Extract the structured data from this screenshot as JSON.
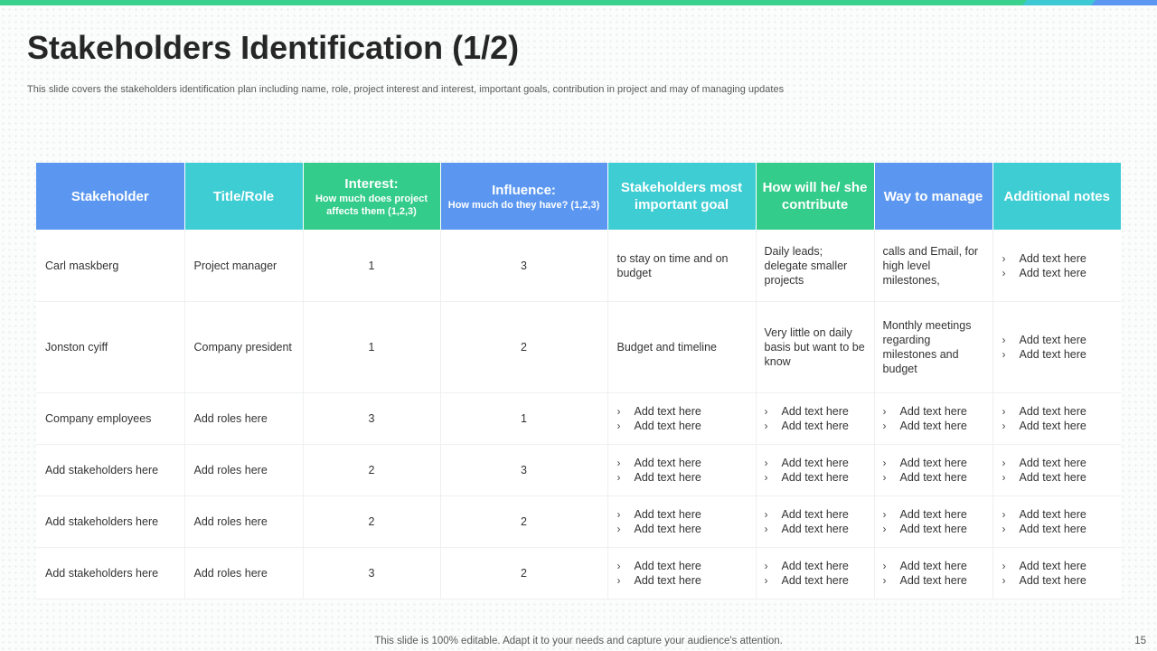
{
  "slide": {
    "title": "Stakeholders Identification (1/2)",
    "subtitle": "This slide covers the stakeholders identification plan including name, role, project interest and interest, important goals, contribution in project and may of managing updates",
    "footer": "This slide is 100% editable. Adapt it to your needs and capture your audience's attention.",
    "page_number": "15"
  },
  "colors": {
    "blue": "#5b97f0",
    "teal": "#3ecdd3",
    "green": "#33cc8a"
  },
  "table": {
    "headers": [
      {
        "label": "Stakeholder",
        "sub": ""
      },
      {
        "label": "Title/Role",
        "sub": ""
      },
      {
        "label": "Interest:",
        "sub": "How much does project affects them (1,2,3)"
      },
      {
        "label": "Influence:",
        "sub": "How much do they have? (1,2,3)"
      },
      {
        "label": "Stakeholders most important goal",
        "sub": ""
      },
      {
        "label": "How will he/ she contribute",
        "sub": ""
      },
      {
        "label": "Way to manage",
        "sub": ""
      },
      {
        "label": "Additional notes",
        "sub": ""
      }
    ],
    "rows": [
      {
        "stakeholder": "Carl maskberg",
        "role": "Project manager",
        "interest": "1",
        "influence": "3",
        "goal": "to stay on time and on budget",
        "contribute": "Daily leads; delegate smaller projects",
        "manage": "calls and Email, for high level milestones,",
        "notes": [
          "Add text here",
          "Add text here"
        ]
      },
      {
        "stakeholder": "Jonston cyiff",
        "role": "Company president",
        "interest": "1",
        "influence": "2",
        "goal": "Budget and timeline",
        "contribute": "Very little on daily basis but want to be know",
        "manage": "Monthly meetings regarding milestones and budget",
        "notes": [
          "Add text here",
          "Add text here"
        ]
      },
      {
        "stakeholder": "Company employees",
        "role": "Add roles here",
        "interest": "3",
        "influence": "1",
        "goal": [
          "Add text here",
          "Add text here"
        ],
        "contribute": [
          "Add text here",
          "Add text here"
        ],
        "manage": [
          "Add text here",
          "Add text here"
        ],
        "notes": [
          "Add text here",
          "Add text here"
        ]
      },
      {
        "stakeholder": "Add stakeholders here",
        "role": "Add roles here",
        "interest": "2",
        "influence": "3",
        "goal": [
          "Add text here",
          "Add text here"
        ],
        "contribute": [
          "Add text here",
          "Add text here"
        ],
        "manage": [
          "Add text here",
          "Add text here"
        ],
        "notes": [
          "Add text here",
          "Add text here"
        ]
      },
      {
        "stakeholder": "Add stakeholders here",
        "role": "Add roles here",
        "interest": "2",
        "influence": "2",
        "goal": [
          "Add text here",
          "Add text here"
        ],
        "contribute": [
          "Add text here",
          "Add text here"
        ],
        "manage": [
          "Add text here",
          "Add text here"
        ],
        "notes": [
          "Add text here",
          "Add text here"
        ]
      },
      {
        "stakeholder": "Add stakeholders here",
        "role": "Add roles here",
        "interest": "3",
        "influence": "2",
        "goal": [
          "Add text here",
          "Add text here"
        ],
        "contribute": [
          "Add text here",
          "Add text here"
        ],
        "manage": [
          "Add text here",
          "Add text here"
        ],
        "notes": [
          "Add text here",
          "Add text here"
        ]
      }
    ]
  }
}
